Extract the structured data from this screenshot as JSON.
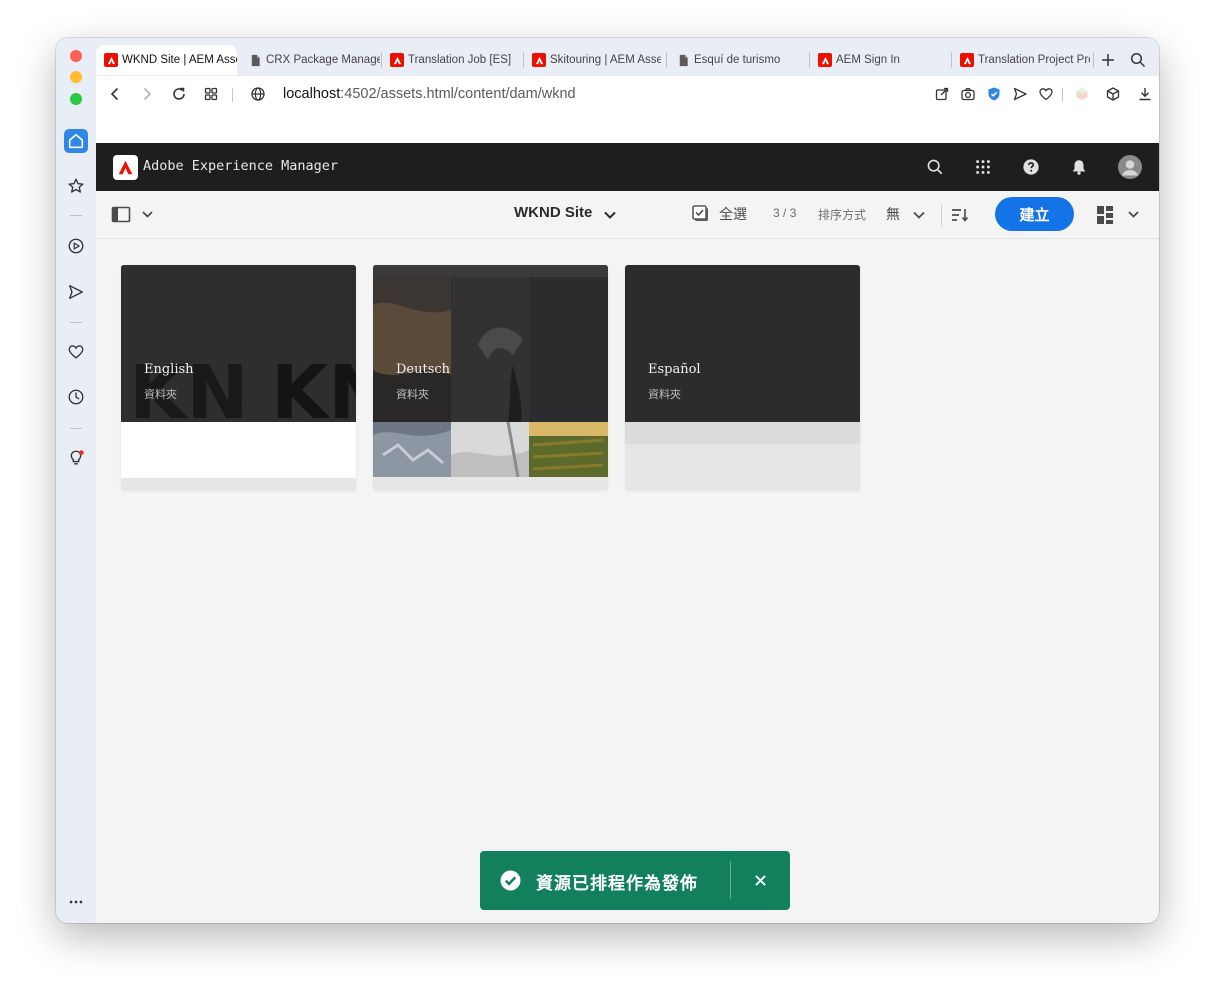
{
  "browser": {
    "tabs": [
      {
        "label": "WKND Site | AEM Assets",
        "icon": "adobe-icon",
        "active": true
      },
      {
        "label": "CRX Package Manager",
        "icon": "document-icon"
      },
      {
        "label": "Translation Job [ES]",
        "icon": "adobe-icon"
      },
      {
        "label": "Skitouring | AEM Assets",
        "icon": "adobe-icon"
      },
      {
        "label": "Esquí de turismo",
        "icon": "document-icon"
      },
      {
        "label": "AEM Sign In",
        "icon": "adobe-icon"
      },
      {
        "label": "Translation Project Properties",
        "icon": "adobe-icon"
      }
    ],
    "url_host": "localhost",
    "url_rest": ":4502/assets.html/content/dam/wknd"
  },
  "aem": {
    "product_title": "Adobe Experience Manager",
    "breadcrumb_title": "WKND Site",
    "select_all_label": "全選",
    "count_current": "3",
    "count_separator": "/",
    "count_total": "3",
    "sort_label": "排序方式",
    "sort_value": "無",
    "create_label": "建立"
  },
  "folders": [
    {
      "name": "English",
      "type": "資料夾"
    },
    {
      "name": "Deutsch",
      "type": "資料夾"
    },
    {
      "name": "Español",
      "type": "資料夾"
    }
  ],
  "toast": {
    "message": "資源已排程作為發佈"
  },
  "colors": {
    "accent": "#1473e6",
    "toast_bg": "#12805c",
    "header_bg": "#1e1e1e",
    "adobe_red": "#eb1000"
  }
}
